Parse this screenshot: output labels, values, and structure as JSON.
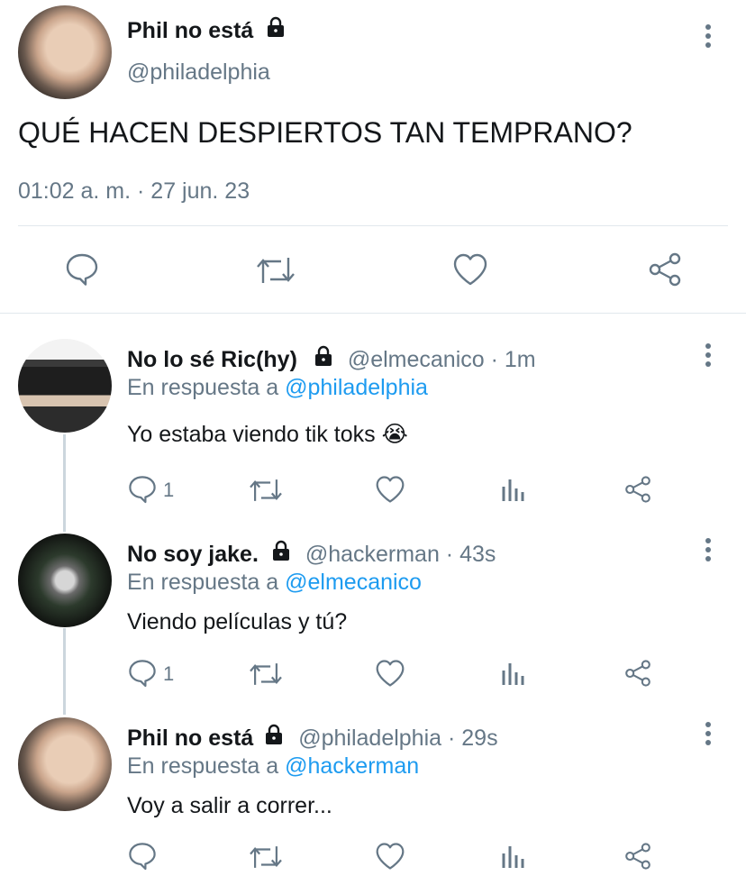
{
  "main_tweet": {
    "author_name": "Phil no está",
    "handle": "@philadelphia",
    "text": "QUÉ HACEN DESPIERTOS TAN TEMPRANO?",
    "timestamp": "01:02 a. m. · 27 jun. 23"
  },
  "replies": [
    {
      "author_name": "No lo sé Ric(hy)",
      "handle_time": "@elmecanico · 1m",
      "reply_prefix": "En respuesta a",
      "reply_to": "@philadelphia",
      "text": "Yo estaba viendo tik toks 😭",
      "reply_count": "1"
    },
    {
      "author_name": "No soy jake.",
      "handle_time": "@hackerman · 43s",
      "reply_prefix": "En respuesta a",
      "reply_to": "@elmecanico",
      "text": "Viendo películas y tú?",
      "reply_count": "1"
    },
    {
      "author_name": "Phil no está",
      "handle_time": "@philadelphia · 29s",
      "reply_prefix": "En respuesta a",
      "reply_to": "@hackerman",
      "text": "Voy a salir a correr...",
      "reply_count": ""
    }
  ],
  "colors": {
    "text": "#14171a",
    "secondary": "#657786",
    "link": "#1d9bf0",
    "divider": "#e1e8ed"
  }
}
